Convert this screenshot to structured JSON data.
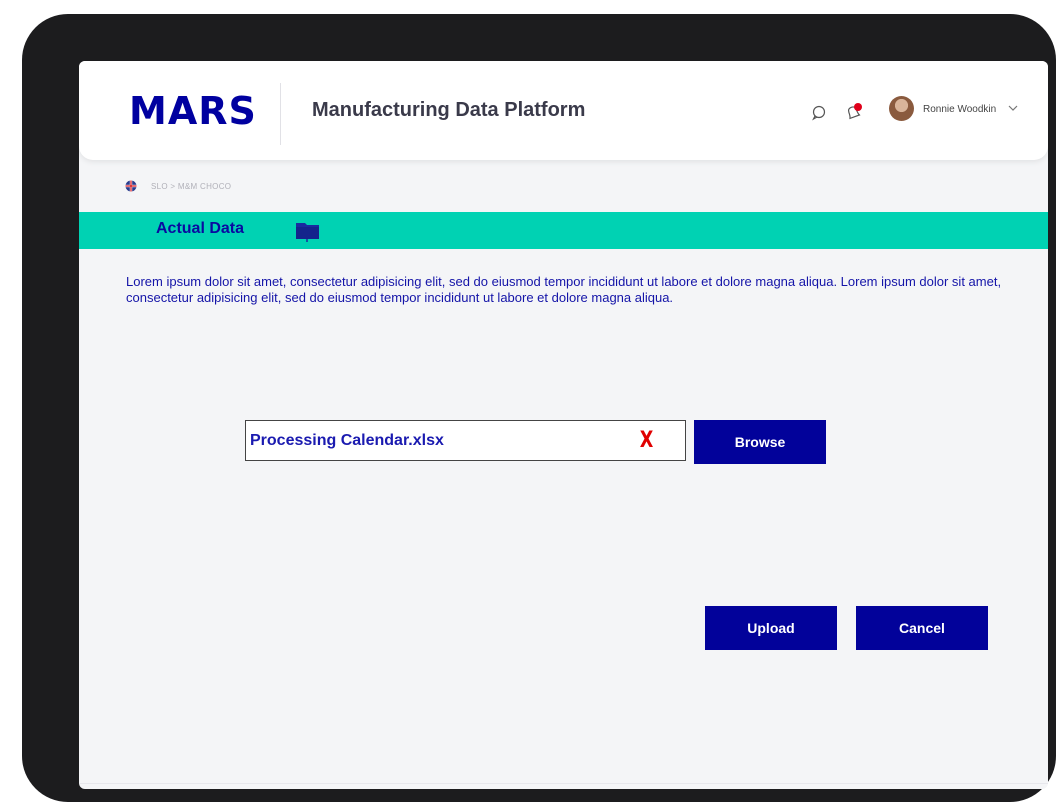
{
  "header": {
    "logo": "MARS",
    "app_title": "Manufacturing Data Platform",
    "user_name": "Ronnie Woodkin",
    "icons": {
      "chat": "chat-icon",
      "bell": "bell-icon",
      "chevron": "chevron-down-icon"
    }
  },
  "breadcrumb": {
    "flag": "uk-flag-icon",
    "path": "SLO > M&M CHOCO"
  },
  "banner": {
    "title": "Actual Data",
    "icon": "folder-icon"
  },
  "description": "Lorem ipsum dolor sit amet, consectetur adipisicing elit, sed do eiusmod tempor incididunt ut labore et dolore magna aliqua. Lorem ipsum dolor sit amet, consectetur adipisicing elit, sed do eiusmod tempor incididunt ut labore et dolore magna aliqua.",
  "file_input": {
    "value": "Processing Calendar.xlsx",
    "clear_label": "X"
  },
  "buttons": {
    "browse": "Browse",
    "upload": "Upload",
    "cancel": "Cancel"
  },
  "colors": {
    "brand": "#0000a0",
    "banner": "#00d2b3",
    "button": "#02029a",
    "clear": "#e00000"
  }
}
